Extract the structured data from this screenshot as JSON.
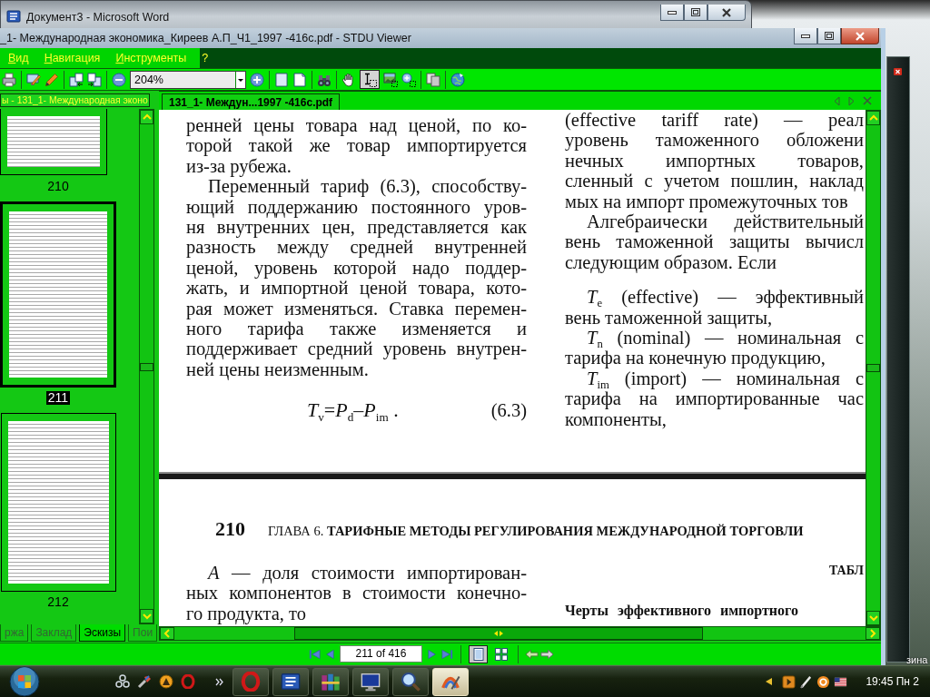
{
  "word_window": {
    "title": "Документ3 - Microsoft Word"
  },
  "viewer_window": {
    "title": "_1- Международная экономика_Киреев А.П_Ч1_1997 -416c.pdf - STDU Viewer"
  },
  "menu": [
    {
      "label": "Вид"
    },
    {
      "label": "Навигация"
    },
    {
      "label": "Инструменты"
    },
    {
      "label": "?"
    }
  ],
  "toolbar": {
    "groups": [
      [
        {
          "kind": "print"
        }
      ],
      [
        {
          "kind": "edit"
        },
        {
          "kind": "pen"
        }
      ],
      [
        {
          "kind": "pages_left"
        },
        {
          "kind": "pages_right"
        }
      ],
      [
        {
          "kind": "zoom_out"
        },
        {
          "kind": "zoom_field",
          "value": "204%"
        },
        {
          "kind": "zoom_in"
        }
      ],
      [
        {
          "kind": "page_single"
        },
        {
          "kind": "page_wide"
        }
      ],
      [
        {
          "kind": "find"
        }
      ],
      [
        {
          "kind": "hand",
          "selected": false
        },
        {
          "kind": "text_select",
          "selected": true
        },
        {
          "kind": "snapshot",
          "selected": false
        },
        {
          "kind": "zoom_area",
          "selected": false
        }
      ],
      [
        {
          "kind": "copy"
        }
      ],
      [
        {
          "kind": "update"
        }
      ]
    ]
  },
  "sidebar": {
    "title": "ы - 131_1- Международная эконо",
    "thumbnails": [
      {
        "label": "210",
        "selected": false
      },
      {
        "label": "211",
        "selected": true
      },
      {
        "label": "212",
        "selected": false
      }
    ],
    "tabs": [
      {
        "label": "ржа",
        "selected": false
      },
      {
        "label": "Заклад",
        "selected": false
      },
      {
        "label": "Эскизы",
        "selected": true
      },
      {
        "label": "Пои",
        "selected": false
      }
    ]
  },
  "document_tabs": [
    {
      "label": "131_1- Междун...1997 -416c.pdf",
      "selected": true
    }
  ],
  "page_upper": {
    "left": [
      {
        "lines": [
          "ренней цены товара над ценой, по ко-",
          "торой такой же товар импортируется",
          "из-за рубежа."
        ]
      },
      {
        "lines": [
          "Переменный тариф (6.3), способству-",
          "ющий поддержанию постоянного уров-",
          "ня внутренних цен, представляется как",
          "разность между средней внутренней",
          "ценой, уровень которой надо поддер-",
          "жать, и импортной ценой товара, кото-",
          "рая может изменяться. Ставка перемен-",
          "ного тарифа также изменяется и",
          "поддерживает средний уровень внутрен-",
          "ней цены неизменным."
        ]
      }
    ],
    "formula": "*T*$_{v}$=*P*$_{d}$–*P*$_{im}$ .",
    "formula_number": "(6.3)",
    "right": [
      {
        "lines": [
          "(effective tariff rate) — реал",
          "уровень таможенного обложени",
          "нечных импортных товаров,",
          "сленный с учетом пошлин, наклад",
          "мых на импорт промежуточных тов"
        ]
      },
      {
        "lines": [
          "Алгебраически действительный",
          "вень таможенной защиты вычисл",
          "следующим образом. Если"
        ]
      }
    ],
    "definitions": [
      {
        "lines": [
          "*T*$_{e}$ (effective) — эффективный",
          "вень таможенной защиты,"
        ]
      },
      {
        "lines": [
          "*T*$_{n}$ (nominal) — номинальная с",
          "тарифа на конечную продукцию,"
        ]
      },
      {
        "lines": [
          "*T*$_{im}$ (import) — номинальная с",
          "тарифа на импортированные час",
          "компоненты,"
        ]
      }
    ]
  },
  "page_lower": {
    "page_number": "210",
    "running_head": "ГЛАВА 6. **ТАРИФНЫЕ МЕТОДЫ РЕГУЛИРОВАНИЯ МЕЖДУНАРОДНОЙ ТОРГОВЛИ**",
    "left": [
      {
        "lines": [
          "*А* — доля стоимости импортирован-",
          "ных компонентов в стоимости конечно-",
          "го продукта, то"
        ]
      }
    ],
    "table_label": "ТАБЛ",
    "table_title": "Черты эффективного импортного"
  },
  "navigation": {
    "page_field": "211 of 416",
    "views": [
      {
        "kind": "single",
        "selected": true
      },
      {
        "kind": "grid",
        "selected": false
      }
    ]
  },
  "taskbar": {
    "quick_launch": [
      {
        "kind": "network"
      },
      {
        "kind": "brush"
      },
      {
        "kind": "badge"
      },
      {
        "kind": "ring"
      }
    ],
    "tasks": [
      {
        "kind": "ring",
        "selected": false
      },
      {
        "kind": "document",
        "selected": false
      },
      {
        "kind": "books",
        "selected": false
      },
      {
        "kind": "monitor",
        "selected": false
      },
      {
        "kind": "magnifier",
        "selected": false
      },
      {
        "kind": "arc",
        "selected": true
      }
    ],
    "tray": [
      {
        "kind": "play"
      },
      {
        "kind": "pen"
      },
      {
        "kind": "swirl"
      },
      {
        "kind": "flag"
      }
    ],
    "clock": "19:45 Пн 2"
  },
  "desktop": {
    "icon_label": "зина"
  }
}
